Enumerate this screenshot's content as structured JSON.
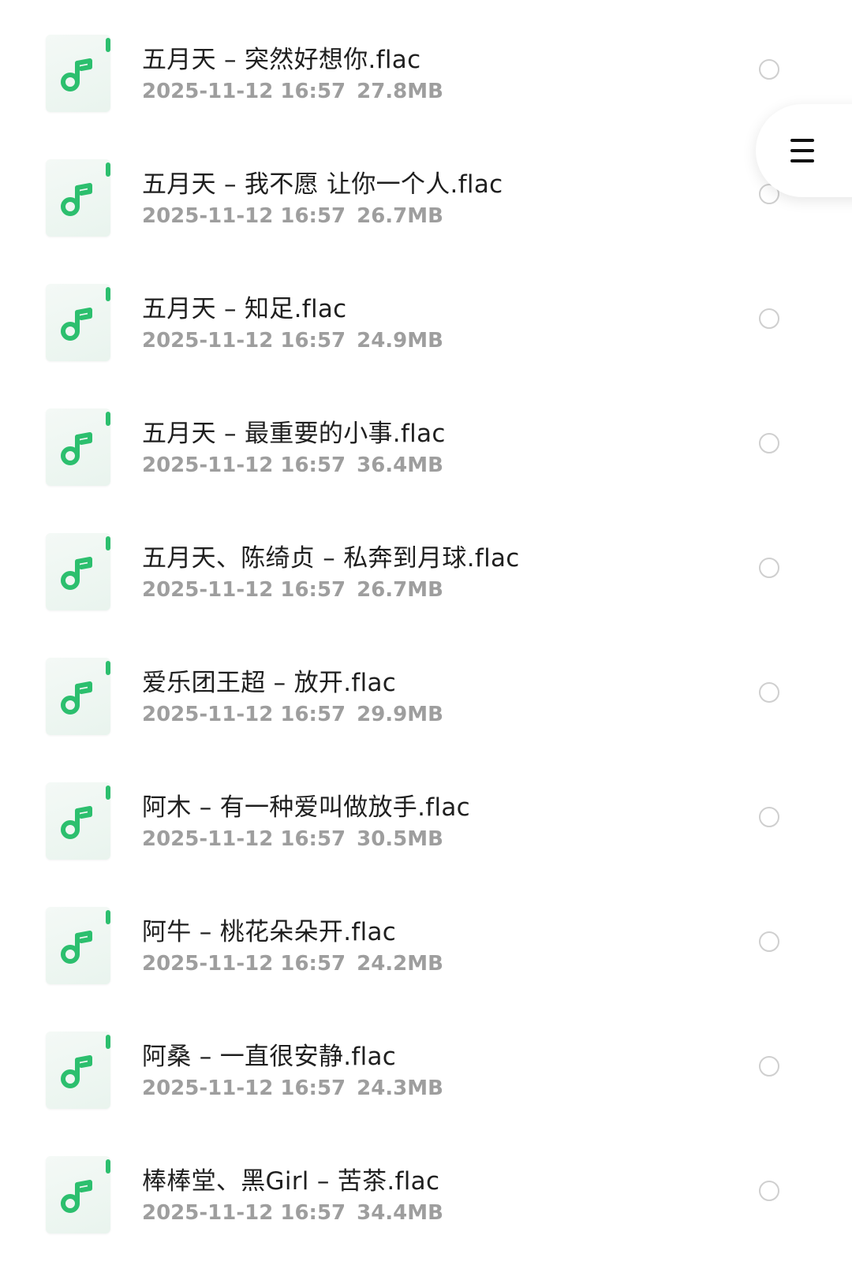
{
  "files": [
    {
      "name": "五月天 – 突然好想你.flac",
      "date": "2025-11-12 16:57",
      "size": "27.8MB"
    },
    {
      "name": "五月天 – 我不愿 让你一个人.flac",
      "date": "2025-11-12 16:57",
      "size": "26.7MB"
    },
    {
      "name": "五月天 – 知足.flac",
      "date": "2025-11-12 16:57",
      "size": "24.9MB"
    },
    {
      "name": "五月天 – 最重要的小事.flac",
      "date": "2025-11-12 16:57",
      "size": "36.4MB"
    },
    {
      "name": "五月天、陈绮贞 – 私奔到月球.flac",
      "date": "2025-11-12 16:57",
      "size": "26.7MB"
    },
    {
      "name": "爱乐团王超 – 放开.flac",
      "date": "2025-11-12 16:57",
      "size": "29.9MB"
    },
    {
      "name": "阿木 – 有一种爱叫做放手.flac",
      "date": "2025-11-12 16:57",
      "size": "30.5MB"
    },
    {
      "name": "阿牛 – 桃花朵朵开.flac",
      "date": "2025-11-12 16:57",
      "size": "24.2MB"
    },
    {
      "name": "阿桑 – 一直很安静.flac",
      "date": "2025-11-12 16:57",
      "size": "24.3MB"
    },
    {
      "name": "棒棒堂、黑Girl – 苦茶.flac",
      "date": "2025-11-12 16:57",
      "size": "34.4MB"
    }
  ],
  "icons": {
    "file": "music-note-icon",
    "menu": "hamburger-menu-icon",
    "select": "radio-unchecked-icon"
  },
  "colors": {
    "accent": "#2cbf6e",
    "name_text": "#1f1f1f",
    "meta_text": "#9e9e9e",
    "radio_border": "#cfcfcf"
  }
}
